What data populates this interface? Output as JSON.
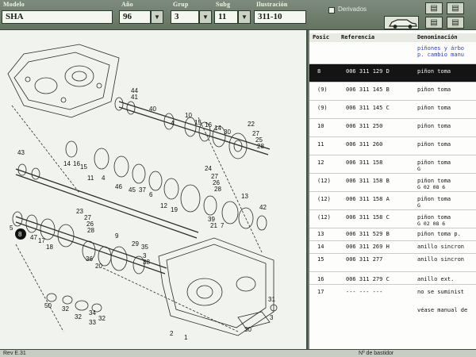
{
  "toolbar": {
    "modelo": {
      "label": "Modelo",
      "value": "SHA"
    },
    "ano": {
      "label": "Año",
      "value": "96"
    },
    "grup": {
      "label": "Grup",
      "value": "3"
    },
    "subg": {
      "label": "Subg",
      "value": "11"
    },
    "ilustracion": {
      "label": "Ilustración",
      "value": "311-10"
    },
    "derivados_label": "Derivados",
    "icons": [
      "book-icon",
      "book-icon",
      "book-icon",
      "book-icon",
      "car-icon"
    ]
  },
  "diagram": {
    "part_numbers": [
      "44",
      "41",
      "40",
      "4",
      "10",
      "15",
      "16",
      "14",
      "30",
      "22",
      "27",
      "25",
      "28",
      "43",
      "14",
      "16",
      "15",
      "11",
      "4",
      "46",
      "45",
      "37",
      "6",
      "24",
      "27",
      "26",
      "28",
      "12",
      "19",
      "13",
      "42",
      "39",
      "21",
      "7",
      "23",
      "27",
      "26",
      "28",
      "5",
      "8",
      "47",
      "17",
      "18",
      "36",
      "20",
      "9",
      "29",
      "35",
      "3",
      "38",
      "32",
      "31",
      "50",
      "32",
      "34",
      "33",
      "32",
      "30",
      "2",
      "1",
      "3"
    ]
  },
  "table": {
    "headers": {
      "pos": "Posic",
      "ref": "Referencia",
      "den": "Denominación"
    },
    "group_title": [
      "piñones y árbo",
      "p. cambio manu"
    ],
    "rows": [
      {
        "pos": "8",
        "ref": "006 311 129 D",
        "den": "piñon toma",
        "sub": "",
        "selected": true
      },
      {
        "pos": "(9)",
        "ref": "006 311 145 B",
        "den": "piñon toma",
        "sub": "",
        "selected": false
      },
      {
        "pos": "(9)",
        "ref": "006 311 145 C",
        "den": "piñon toma",
        "sub": "",
        "selected": false
      },
      {
        "pos": "10",
        "ref": "006 311 250",
        "den": "piñon toma",
        "sub": "",
        "selected": false
      },
      {
        "pos": "11",
        "ref": "006 311 260",
        "den": "piñon toma",
        "sub": "",
        "selected": false
      },
      {
        "pos": "12",
        "ref": "006 311 158",
        "den": "piñon toma",
        "sub": "G",
        "selected": false
      },
      {
        "pos": "(12)",
        "ref": "006 311 158 B",
        "den": "piñon toma",
        "sub": "G         02 08 6",
        "selected": false
      },
      {
        "pos": "(12)",
        "ref": "006 311 158 A",
        "den": "piñon toma",
        "sub": "G",
        "selected": false
      },
      {
        "pos": "(12)",
        "ref": "006 311 158 C",
        "den": "piñon toma",
        "sub": "G         02 08 6",
        "selected": false
      },
      {
        "pos": "13",
        "ref": "006 311 529 B",
        "den": "piñon toma p.",
        "sub": "",
        "selected": false
      },
      {
        "pos": "14",
        "ref": "006 311 269 H",
        "den": "anillo sincron",
        "sub": "",
        "selected": false
      },
      {
        "pos": "15",
        "ref": "006 311 277",
        "den": "anillo sincron",
        "sub": "",
        "selected": false
      },
      {
        "pos": "16",
        "ref": "006 311 279 C",
        "den": "anillo ext.",
        "sub": "",
        "selected": false
      },
      {
        "pos": "17",
        "ref": "--- --- ---",
        "den": "no se suminist",
        "sub": "",
        "selected": false
      },
      {
        "pos": "",
        "ref": "",
        "den": "véase manual de",
        "sub": "",
        "selected": false
      }
    ]
  },
  "status": {
    "left": "Rev E.31",
    "right": "Nº de bastidor"
  }
}
